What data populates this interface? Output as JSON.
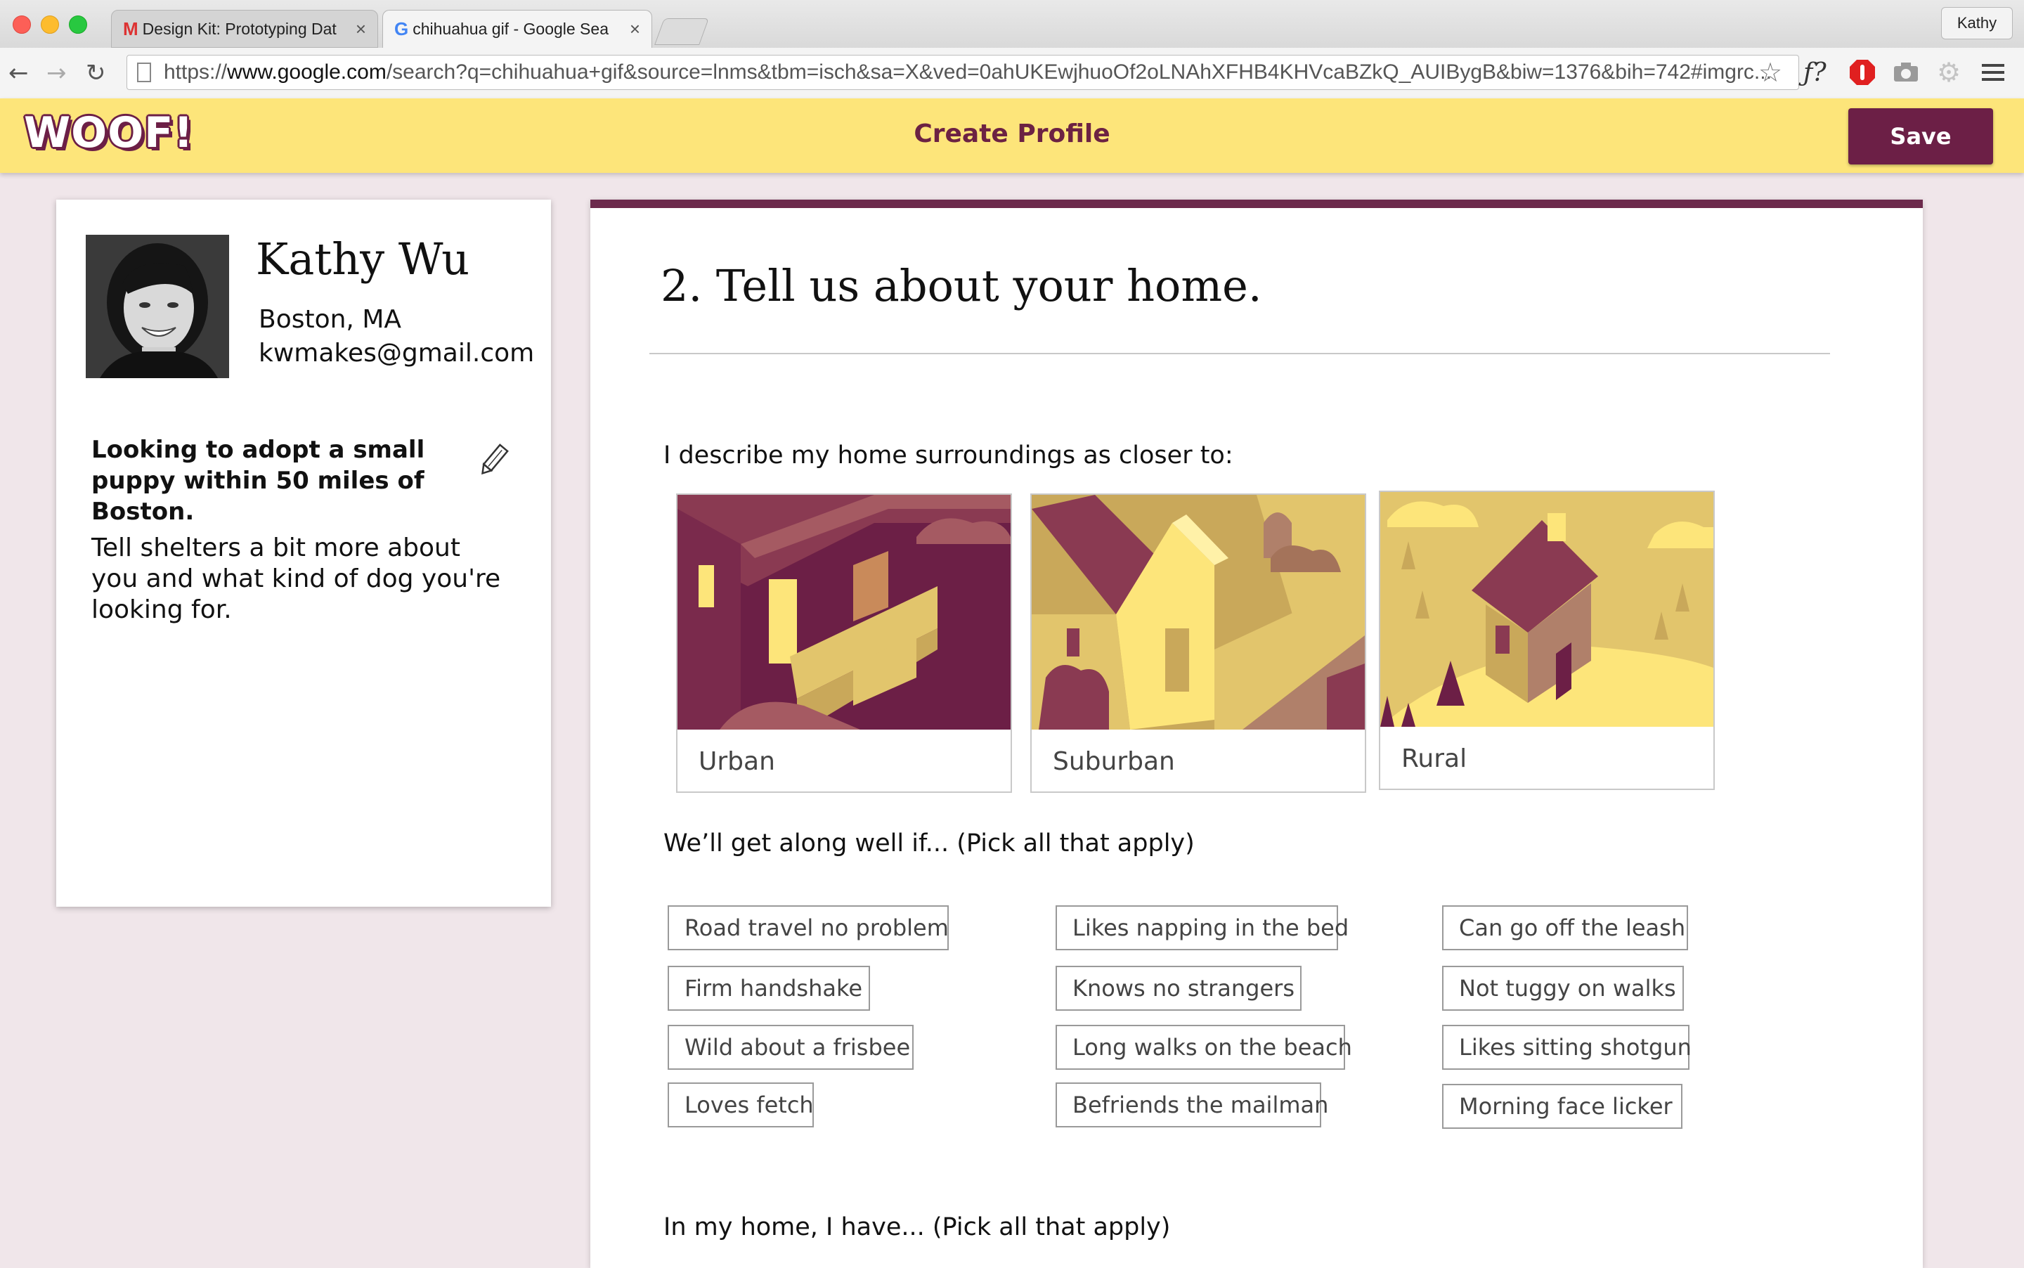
{
  "browser": {
    "tabs": [
      {
        "title": "Design Kit: Prototyping Dat"
      },
      {
        "title": "chihuahua gif - Google Sea"
      }
    ],
    "url_scheme": "https://",
    "url_host": "www.google.com",
    "url_path": "/search?q=chihuahua+gif&source=lnms&tbm=isch&sa=X&ved=0ahUKEwjhuoOf2oLNAhXFHB4KHVcaBZkQ_AUIBygB&biw=1376&bih=742#imgrc...",
    "user": "Kathy",
    "ext_label": "ƒ?"
  },
  "header": {
    "logo": "WOOF!",
    "title": "Create Profile",
    "save_label": "Save"
  },
  "profile": {
    "name": "Kathy Wu",
    "location": "Boston, MA",
    "email": "kwmakes@gmail.com",
    "adopt_text": "Looking to adopt a small puppy within 50 miles of Boston.",
    "tell_text": "Tell shelters a bit more about you and what kind of dog you're looking for."
  },
  "form": {
    "section_title": "2. Tell us about your home.",
    "q_surroundings": "I describe my home surroundings as closer to:",
    "surroundings": [
      {
        "label": "Urban"
      },
      {
        "label": "Suburban"
      },
      {
        "label": "Rural"
      }
    ],
    "q_traits": "We’ll get along well if... (Pick all that apply)",
    "traits": {
      "col1": [
        "Road travel no problem",
        "Firm handshake",
        "Wild about a frisbee",
        "Loves fetch"
      ],
      "col2": [
        "Likes napping in the bed",
        "Knows no strangers",
        "Long walks on the beach",
        "Befriends the mailman"
      ],
      "col3": [
        "Can go off the leash",
        "Not tuggy on walks",
        "Likes sitting shotgun",
        "Morning face licker"
      ]
    },
    "q_home_items": "In my home, I have... (Pick all that apply)"
  },
  "colors": {
    "accent": "#6c1f46",
    "header_bg": "#fde57a",
    "page_bg": "#f0e6ea"
  }
}
